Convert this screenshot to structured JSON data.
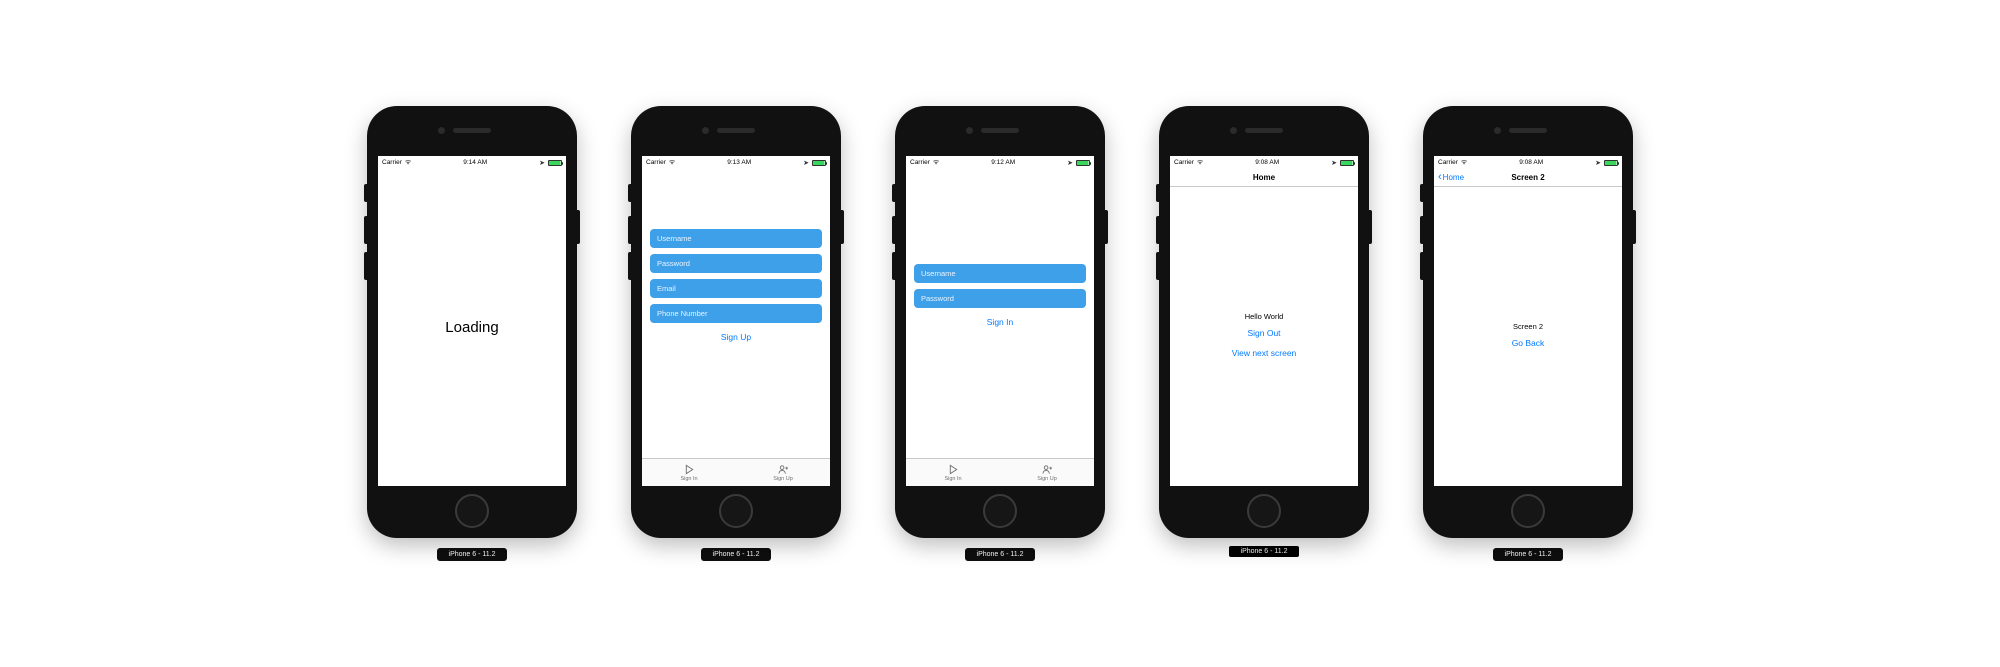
{
  "sim_label": "iPhone 6 - 11.2",
  "status": {
    "carrier": "Carrier",
    "times": [
      "9:14 AM",
      "9:13 AM",
      "9:12 AM",
      "9:08 AM",
      "9:08 AM"
    ]
  },
  "screen1": {
    "loading": "Loading"
  },
  "screen2": {
    "fields": {
      "username": "Username",
      "password": "Password",
      "email": "Email",
      "phone": "Phone Number"
    },
    "signup": "Sign Up",
    "tab_signin": "Sign In",
    "tab_signup": "Sign Up"
  },
  "screen3": {
    "fields": {
      "username": "Username",
      "password": "Password"
    },
    "signin": "Sign In",
    "tab_signin": "Sign In",
    "tab_signup": "Sign Up"
  },
  "screen4": {
    "title": "Home",
    "hello": "Hello World",
    "signout": "Sign Out",
    "viewnext": "View next screen"
  },
  "screen5": {
    "title": "Screen 2",
    "back": "Home",
    "label": "Screen 2",
    "goback": "Go Back"
  }
}
